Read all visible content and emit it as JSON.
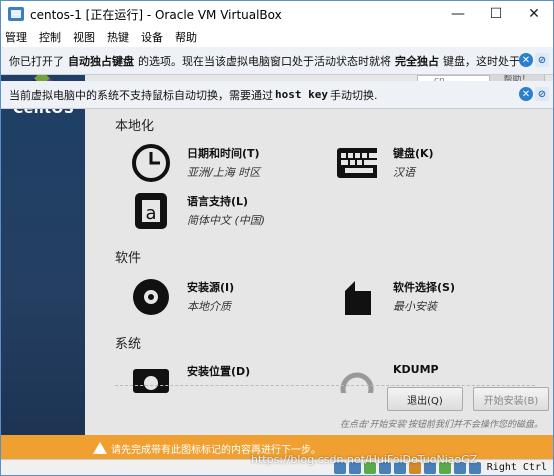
{
  "window": {
    "title": "centos-1 [正在运行] - Oracle VM VirtualBox",
    "controls": {
      "minimize": "—",
      "maximize": "☐",
      "close": "✕"
    }
  },
  "menubar": [
    "管理",
    "控制",
    "视图",
    "热键",
    "设备",
    "帮助"
  ],
  "notices": {
    "first": {
      "pre": "你已打开了",
      "bold1": "自动独占键盘",
      "mid": "的选项。现在当该虚拟电脑窗口处于活动状态时就将",
      "bold2": "完全独占",
      "post": "键盘，这时处于"
    },
    "second": {
      "pre": "当前虚拟电脑中的系统不支持鼠标自动切换，需要通过",
      "bold": "host key",
      "post": "手动切换."
    }
  },
  "guest": {
    "sidebar_brand": "CentOS",
    "search_placeholder": "cn",
    "help_label": "帮助！",
    "sections": {
      "localization": "本地化",
      "software": "软件",
      "system": "系统"
    },
    "spokes": {
      "datetime": {
        "title": "日期和时间(T)",
        "sub": "亚洲/上海 时区"
      },
      "keyboard": {
        "title": "键盘(K)",
        "sub": "汉语"
      },
      "language": {
        "title": "语言支持(L)",
        "sub": "简体中文 (中国)"
      },
      "source": {
        "title": "安装源(I)",
        "sub": "本地介质"
      },
      "selection": {
        "title": "软件选择(S)",
        "sub": "最小安装"
      },
      "destination": {
        "title": "安装位置(D)",
        "sub": ""
      },
      "kdump": {
        "title": "KDUMP",
        "sub": ""
      }
    },
    "buttons": {
      "quit": "退出(Q)",
      "start": "开始安装(B)"
    },
    "footnote": "在点击'开始安装'按钮前我们并不会操作您的磁盘。",
    "warning": "请先完成带有此图标标记的内容再进行下一步。"
  },
  "statusbar": {
    "host_key": "Right Ctrl"
  },
  "watermark": "https://blog.csdn.net/HuiFeiDeTuoNiaoGZ"
}
